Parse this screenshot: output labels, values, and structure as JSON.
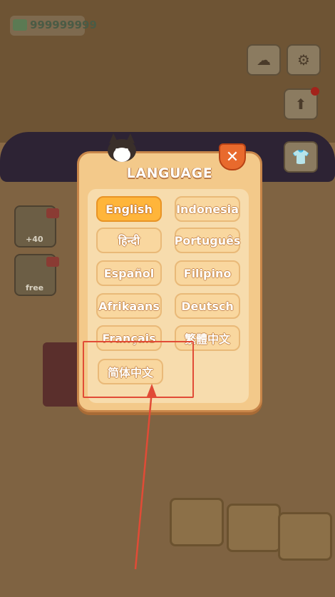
{
  "hud": {
    "money": "999999999",
    "offer_plus": "+40",
    "offer_free": "free"
  },
  "dialog": {
    "title": "LANGUAGE",
    "close_label": "✕",
    "selected": "English",
    "languages": [
      "English",
      "Indonesia",
      "हिन्दी",
      "Português",
      "Español",
      "Filipino",
      "Afrikaans",
      "Deutsch",
      "Français",
      "繁體中文",
      "简体中文"
    ]
  },
  "annotation": {
    "highlight_color": "#e14b36",
    "target": "简体中文"
  },
  "colors": {
    "dialog_bg": "#f3c98a",
    "button_bg": "#f9d79f",
    "selected_bg": "#ffb53a"
  }
}
